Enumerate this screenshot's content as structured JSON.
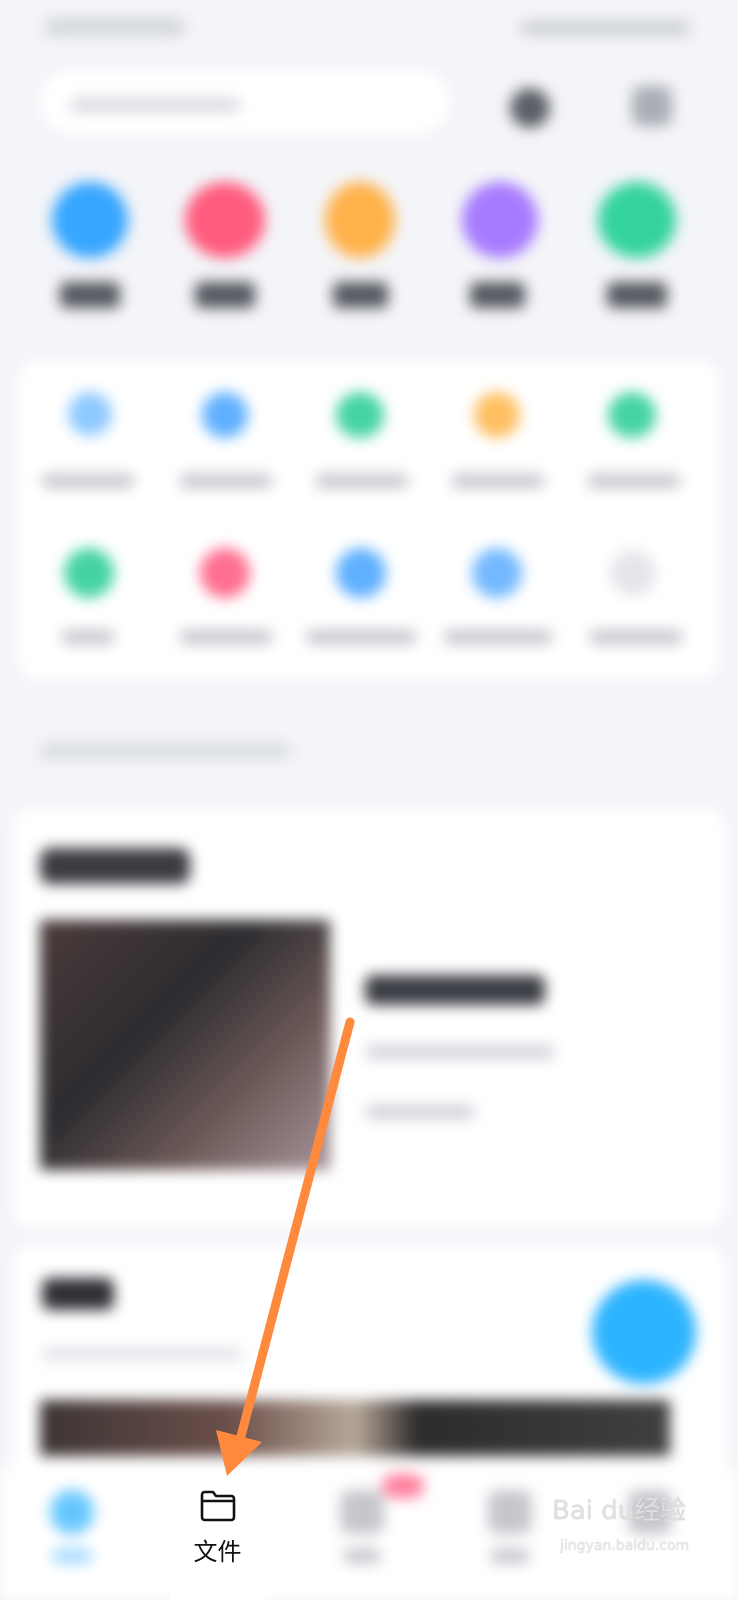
{
  "bottom_nav": {
    "files_label": "文件"
  },
  "watermark": {
    "text": "Bai du经验",
    "sub": "jingyan.baidu.com"
  },
  "colors": {
    "accent": "#2db4ff",
    "arrow": "#ff8a3d",
    "top_icons": [
      "#36a6ff",
      "#ff5c7e",
      "#ffb24a",
      "#a77bff",
      "#34d39e"
    ],
    "grid_icons_row1": [
      "#8ec9ff",
      "#5fb0ff",
      "#45d3a3",
      "#ffbf62",
      "#45d3a3"
    ],
    "grid_icons_row2": [
      "#45d3a3",
      "#ff6f90",
      "#5fb0ff",
      "#74b8ff",
      "#e4e6ea"
    ]
  },
  "icons": {
    "files": "folder-icon"
  }
}
